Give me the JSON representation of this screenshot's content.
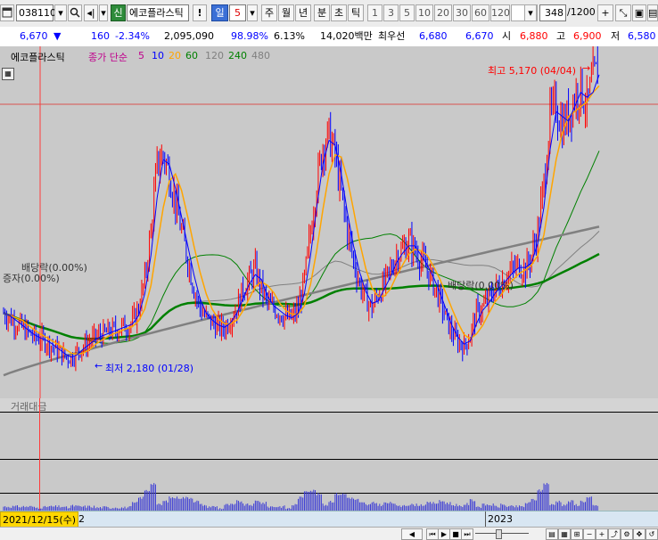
{
  "toolbar": {
    "code": "038110",
    "credit_badge": "신",
    "stock_name": "에코플라스틱",
    "period_value": "5",
    "period_tabs": [
      "일",
      "주",
      "월",
      "년",
      "분",
      "초",
      "틱"
    ],
    "interval_buttons": [
      "1",
      "3",
      "5",
      "10",
      "20",
      "30",
      "60",
      "120"
    ],
    "count_value": "348",
    "count_total": "/1200"
  },
  "infobar": {
    "price": "6,670",
    "change": "160",
    "change_pct": "-2.34%",
    "volume": "2,095,090",
    "vol_ratio": "98.98%",
    "turnover": "6.13%",
    "amount": "14,020백만",
    "best_ask_label": "최우선",
    "best_ask": "6,680",
    "best_bid": "6,670",
    "open_label": "시",
    "open": "6,880",
    "high_label": "고",
    "high": "6,900",
    "low_label": "저",
    "low": "6,580"
  },
  "legend": {
    "name": "에코플라스틱",
    "ma_label": "종가 단순",
    "ma_periods": [
      "5",
      "10",
      "20",
      "60",
      "120",
      "240",
      "480"
    ],
    "ma_colors": [
      "#0000ff",
      "#0000ff",
      "#ffa500",
      "#008000",
      "#808080",
      "#008000",
      "#808080"
    ]
  },
  "annotations": {
    "high": "최고 5,170 (04/04)",
    "low": "최저 2,180 (01/28)",
    "dividend1": "배당락(0.00%)",
    "rights": "증자(0.00%)",
    "dividend2": "배당락(0.00%)"
  },
  "volume_panel": {
    "title": "거래대금"
  },
  "axis": {
    "cursor_date": "2021/12/15(수)",
    "year_label": "2023",
    "prev_label": "2"
  },
  "colors": {
    "up": "#ff0000",
    "down": "#0000ff",
    "chart_bg": "#c9c9c9",
    "ma_fast": "#0000ff",
    "ma_20": "#ffa500",
    "ma_60": "#008000",
    "ma_120": "#808080"
  },
  "chart_data": {
    "type": "candlestick",
    "series_prices": [
      2650,
      2600,
      2550,
      2500,
      2450,
      2400,
      2380,
      2350,
      2300,
      2250,
      2200,
      2180,
      2250,
      2300,
      2350,
      2400,
      2420,
      2450,
      2470,
      2500,
      2520,
      2550,
      2700,
      3000,
      3500,
      4200,
      4300,
      4100,
      3800,
      3500,
      3200,
      2900,
      2700,
      2600,
      2550,
      2500,
      2500,
      2600,
      2700,
      2900,
      3000,
      3100,
      2900,
      2750,
      2700,
      2650,
      2600,
      2600,
      2700,
      3000,
      3500,
      4000,
      4400,
      4500,
      4300,
      3900,
      3500,
      3200,
      2950,
      2800,
      2700,
      2850,
      2950,
      3100,
      3250,
      3300,
      3400,
      3300,
      3200,
      3100,
      2950,
      2800,
      2600,
      2450,
      2350,
      2300,
      2420,
      2650,
      2700,
      2800,
      2900,
      2950,
      3050,
      3100,
      3150,
      3100,
      3250,
      3500,
      4000,
      4700,
      4800,
      4600,
      4700,
      4900,
      5000,
      4800,
      5100,
      5170
    ],
    "high": 5170,
    "low": 2180
  }
}
